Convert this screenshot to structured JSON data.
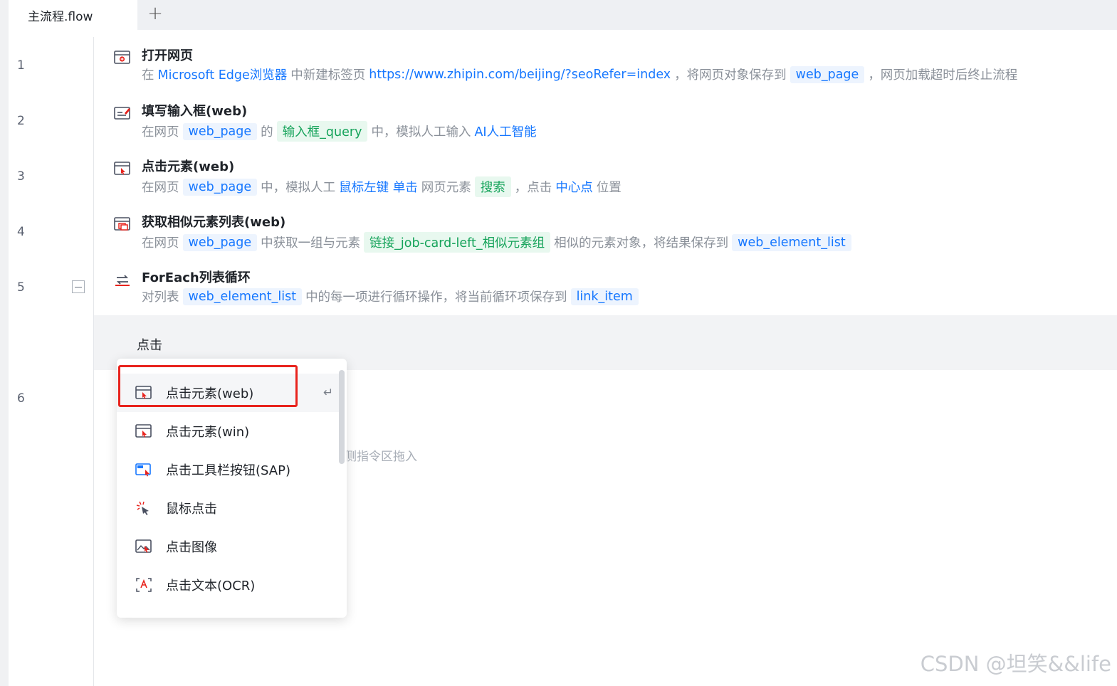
{
  "tabs": {
    "active": "主流程.flow",
    "add": "+"
  },
  "line_numbers": [
    "1",
    "2",
    "3",
    "4",
    "5",
    "6"
  ],
  "steps": [
    {
      "title": "打开网页",
      "desc": [
        "在",
        "Microsoft Edge浏览器",
        "中新建标签页",
        "https://www.zhipin.com/beijing/?seoRefer=index",
        "，将网页对象保存到",
        "web_page",
        "，网页加载超时后终止流程"
      ]
    },
    {
      "title": "填写输入框(web)",
      "desc": [
        "在网页",
        "web_page",
        "的",
        "输入框_query",
        "中，模拟人工输入",
        "AI人工智能"
      ]
    },
    {
      "title": "点击元素(web)",
      "desc": [
        "在网页",
        "web_page",
        "中，模拟人工",
        "鼠标左键 单击",
        "网页元素",
        "搜索",
        "，点击",
        "中心点",
        "位置"
      ]
    },
    {
      "title": "获取相似元素列表(web)",
      "desc": [
        "在网页",
        "web_page",
        "中获取一组与元素",
        "链接_job-card-left_相似元素组",
        "相似的元素对象，将结果保存到",
        "web_element_list"
      ]
    },
    {
      "title": "ForEach列表循环",
      "desc": [
        "对列表",
        "web_element_list",
        "中的每一项进行循环操作，将当前循环项保存到",
        "link_item"
      ]
    }
  ],
  "search": {
    "query": "点击"
  },
  "step6_hint": "侧指令区拖入",
  "dropdown": {
    "enter_symbol": "↵",
    "items": [
      {
        "label": "点击元素(web)",
        "icon": "click-element-web-icon"
      },
      {
        "label": "点击元素(win)",
        "icon": "click-element-win-icon"
      },
      {
        "label": "点击工具栏按钮(SAP)",
        "icon": "sap-toolbar-icon"
      },
      {
        "label": "鼠标点击",
        "icon": "mouse-click-icon"
      },
      {
        "label": "点击图像",
        "icon": "click-image-icon"
      },
      {
        "label": "点击文本(OCR)",
        "icon": "click-ocr-text-icon"
      }
    ]
  },
  "watermark": "CSDN @坦笑&&life",
  "colors": {
    "accent": "#1677ff",
    "element": "#15a35a",
    "highlight": "#e8231d"
  }
}
